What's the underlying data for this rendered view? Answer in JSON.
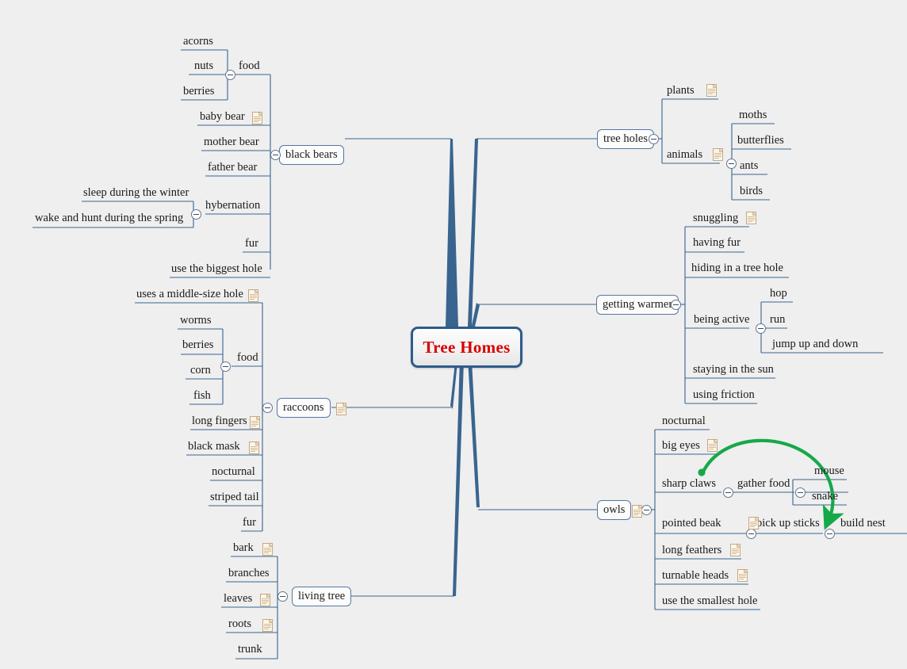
{
  "app": {
    "title": "Tree Homes",
    "background_color": "#efefef",
    "central_node_color": "#d80000",
    "branch_line_color": "#39648f",
    "relationship_arrow_color": "#17a84a",
    "note_icon_color": "#c3a884"
  },
  "central": {
    "label": "Tree Homes"
  },
  "branches": [
    {
      "id": "black-bears",
      "label": "black bears",
      "side": "left",
      "children": [
        {
          "label": "food",
          "children": [
            "acorns",
            "nuts",
            "berries"
          ]
        },
        {
          "label": "baby bear",
          "note": true
        },
        {
          "label": "mother bear"
        },
        {
          "label": "father bear"
        },
        {
          "label": "hybernation",
          "children": [
            "sleep during the winter",
            "wake and hunt during the spring"
          ]
        },
        {
          "label": "fur"
        },
        {
          "label": "use the biggest hole"
        }
      ]
    },
    {
      "id": "raccoons",
      "label": "raccoons",
      "side": "left",
      "note": true,
      "children": [
        {
          "label": "uses a middle-size hole",
          "note": true
        },
        {
          "label": "food",
          "children": [
            "worms",
            "berries",
            "corn",
            "fish"
          ]
        },
        {
          "label": "long fingers",
          "note": true
        },
        {
          "label": "black mask",
          "note": true
        },
        {
          "label": "nocturnal"
        },
        {
          "label": "striped tail"
        },
        {
          "label": "fur"
        }
      ]
    },
    {
      "id": "living-tree",
      "label": "living tree",
      "side": "left",
      "children": [
        {
          "label": "bark",
          "note": true
        },
        {
          "label": "branches"
        },
        {
          "label": "leaves",
          "note": true
        },
        {
          "label": "roots",
          "note": true
        },
        {
          "label": "trunk"
        }
      ]
    },
    {
      "id": "tree-holes",
      "label": "tree holes",
      "side": "right",
      "children": [
        {
          "label": "plants",
          "note": true
        },
        {
          "label": "animals",
          "note": true,
          "children": [
            "moths",
            "butterflies",
            "ants",
            "birds"
          ]
        }
      ]
    },
    {
      "id": "getting-warmer",
      "label": "getting warmer",
      "side": "right",
      "children": [
        {
          "label": "snuggling",
          "note": true
        },
        {
          "label": "having fur"
        },
        {
          "label": "hiding in a tree hole"
        },
        {
          "label": "being active",
          "children": [
            "hop",
            "run",
            "jump up and down"
          ]
        },
        {
          "label": "staying in the sun"
        },
        {
          "label": "using friction"
        }
      ]
    },
    {
      "id": "owls",
      "label": "owls",
      "side": "right",
      "note": true,
      "children": [
        {
          "label": "nocturnal"
        },
        {
          "label": "big eyes",
          "note": true
        },
        {
          "label": "sharp claws",
          "children": [
            {
              "label": "gather food",
              "children": [
                "mouse",
                "snake"
              ]
            }
          ]
        },
        {
          "label": "pointed beak",
          "note": true,
          "children": [
            {
              "label": "pick up sticks",
              "children": [
                "build nest"
              ]
            }
          ]
        },
        {
          "label": "long feathers",
          "note": true
        },
        {
          "label": "turnable heads",
          "note": true
        },
        {
          "label": "use the smallest hole"
        }
      ]
    }
  ],
  "labels": {
    "acorns": "acorns",
    "nuts": "nuts",
    "berries_bear": "berries",
    "food_bear": "food",
    "baby_bear": "baby bear",
    "mother_bear": "mother bear",
    "father_bear": "father bear",
    "sleep_winter": "sleep during the winter",
    "wake_spring": "wake and hunt during the spring",
    "hybernation": "hybernation",
    "fur_bear": "fur",
    "biggest_hole": "use the biggest hole",
    "black_bears": "black bears",
    "middle_hole": "uses a middle-size hole",
    "worms": "worms",
    "berries_rac": "berries",
    "corn": "corn",
    "fish": "fish",
    "food_rac": "food",
    "long_fingers": "long fingers",
    "black_mask": "black mask",
    "nocturnal_rac": "nocturnal",
    "striped_tail": "striped tail",
    "fur_rac": "fur",
    "raccoons": "raccoons",
    "bark": "bark",
    "branches": "branches",
    "leaves": "leaves",
    "roots": "roots",
    "trunk": "trunk",
    "living_tree": "living tree",
    "tree_holes": "tree holes",
    "plants": "plants",
    "animals": "animals",
    "moths": "moths",
    "butterflies": "butterflies",
    "ants": "ants",
    "birds": "birds",
    "getting_warmer": "getting warmer",
    "snuggling": "snuggling",
    "having_fur": "having fur",
    "hiding_tree_hole": "hiding in a tree hole",
    "being_active": "being active",
    "hop": "hop",
    "run": "run",
    "jump_up_down": "jump up and down",
    "staying_sun": "staying in the sun",
    "using_friction": "using friction",
    "owls": "owls",
    "nocturnal_owl": "nocturnal",
    "big_eyes": "big eyes",
    "sharp_claws": "sharp claws",
    "gather_food": "gather food",
    "mouse": "mouse",
    "snake": "snake",
    "pointed_beak": "pointed beak",
    "pick_up_sticks": "pick up sticks",
    "build_nest": "build nest",
    "long_feathers": "long feathers",
    "turnable_heads": "turnable heads",
    "smallest_hole": "use the smallest hole"
  }
}
